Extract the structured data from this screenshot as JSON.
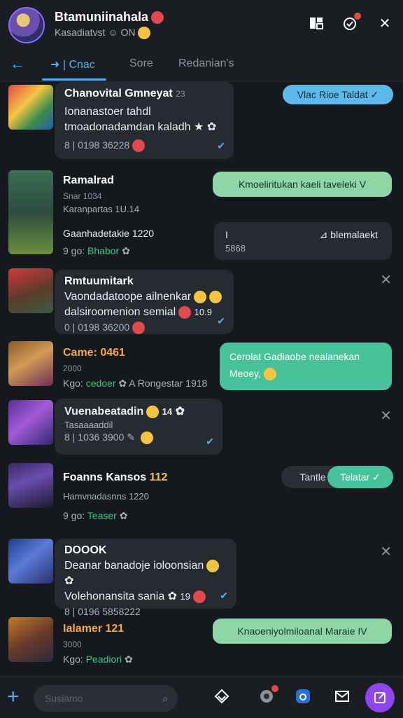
{
  "header": {
    "name": "Btamuniinahala",
    "status": "Kasadiatvst ☺ ON",
    "icons": [
      "layout-icon",
      "chat-refresh-icon",
      "close-icon"
    ]
  },
  "tabs": {
    "back": "←",
    "items": [
      {
        "label": "Cnac",
        "active": true
      },
      {
        "label": "Sore",
        "active": false
      },
      {
        "label": "Redanian's",
        "active": false
      }
    ]
  },
  "messages": {
    "m1": {
      "title": "Chanovital Gmneyat",
      "count": "23",
      "line1": "Ionanastoer tahdl",
      "line2": "tmoadonadamdan kaladh",
      "meta": "8 | 0198 36228",
      "pill": "Vlac Rioe Taldat ✓"
    },
    "m2": {
      "title": "Ramalrad",
      "sub1": "Snar 1034",
      "sub2": "Karanpartas 1U.14",
      "sub3": "Gaanhadetakie 1220",
      "meta_prefix": "9 go:",
      "meta_green": "Bhabor",
      "pill": "Kmoeliritukan kaeli taveleki V",
      "dark_a": "I",
      "dark_b": "blemalaekt",
      "dark_c": "5868"
    },
    "m3": {
      "title": "Rmtuumitark",
      "line1": "Vaondadatoope ailnenkar",
      "line2": "dalsiroomenion semial",
      "extra": "10.9",
      "meta": "0 | 0198 36200"
    },
    "m4": {
      "title": "Came: 0461",
      "sub": "2000",
      "meta_prefix": "Kgo:",
      "meta_green": "cedoer",
      "meta_tail": "A Rongestar 1918",
      "pill": "Cerolat Gadiaobe nealanekan Meoey,"
    },
    "m5": {
      "title": "Vuenabeatadin",
      "count": "14",
      "line1": "Tasaaaaddil",
      "meta": "8 | 1036 3900"
    },
    "m6": {
      "title": "Foanns Kansos",
      "num": "112",
      "sub": "Hamvnadasnns 1220",
      "meta_prefix": "9 go:",
      "meta_green": "Teaser",
      "pill_dark": "Tantle",
      "pill_green": "Telatar ✓"
    },
    "m7": {
      "title": "DOOOK",
      "line1": "Deanar banadoje ioloonsian",
      "line2": "Volehonansita sania",
      "count": "19",
      "meta": "8 | 0196 5858222"
    },
    "m8": {
      "title": "Ialamer 121",
      "sub": "3000",
      "meta_prefix": "Kgo:",
      "meta_green": "Peadiori",
      "pill": "Knaoeniyolmiloanal Maraie IV"
    }
  },
  "bottombar": {
    "search_placeholder": "Susiamo",
    "icons": [
      "layers-icon",
      "shell-icon",
      "camera-icon",
      "mail-icon"
    ]
  },
  "colors": {
    "accent": "#4fb3f2",
    "green": "#35c98a",
    "fab": "#8f44f0"
  }
}
